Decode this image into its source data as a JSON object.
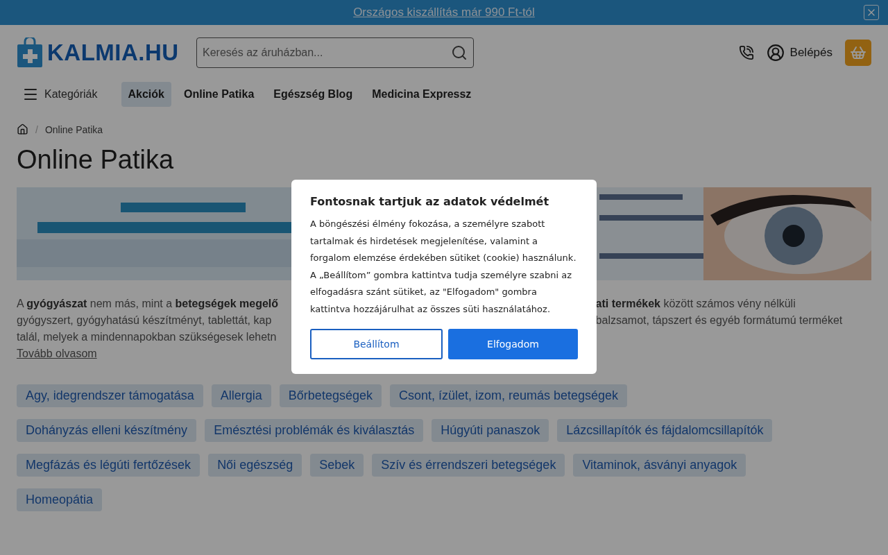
{
  "top_bar": {
    "text": "Országos kiszállítás már 990 Ft-tól"
  },
  "header": {
    "logo": "KALMIA.HU",
    "search": {
      "placeholder": "Keresés az áruházban..."
    },
    "login": "Belépés"
  },
  "nav": {
    "menu_label": "Kategóriák",
    "items": [
      {
        "label": "Akciók",
        "selected": true
      },
      {
        "label": "Online Patika",
        "selected": false
      },
      {
        "label": "Egészség Blog",
        "selected": false
      },
      {
        "label": "Medicina Expressz",
        "selected": false
      }
    ]
  },
  "breadcrumb": {
    "separator": "/",
    "items": [
      "Online Patika"
    ]
  },
  "title": "Online Patika",
  "banner": {
    "kind": "picture"
  },
  "description": {
    "left_lines": [
      "A **gyógyászat** nem más, mint a **betegségek megelő**",
      "gyógyszert, gyógyhatású készítményt, tablettát, kap",
      "talál, melyek a mindennapokban szükségesek lehetn"
    ],
    "right_lines": [
      "**ati termékek** között számos vény nélküli",
      "balzsamot, tápszert és egyéb formátumú terméket"
    ],
    "more_link": "Tovább olvasom"
  },
  "categories": [
    [
      "Agy, idegrendszer támogatása",
      "Allergia",
      "Bőrbetegségek",
      "Csont, ízület, izom, reumás betegségek"
    ],
    [
      "Dohányzás elleni készítmény",
      "Emésztési problémák és kiválasztás",
      "Húgyúti panaszok",
      "Lázcsillapítók és fájdalomcsillapítók"
    ],
    [
      "Megfázás és légúti fertőzések",
      "Női egészség",
      "Sebek",
      "Szív és érrendszeri betegségek",
      "Vitaminok, ásványi anyagok"
    ],
    [
      "Homeopátia"
    ]
  ],
  "cookie_dialog": {
    "title": "Fontosnak tartjuk az adatok védelmét",
    "body": "A böngészési élmény fokozása, a személyre szabott tartalmak és hirdetések megjelenítése, valamint a forgalom elemzése érdekében sütiket (cookie) használunk. A „Beállítom” gombra kattintva tudja személyre szabni az elfogadásra szánt sütiket, az \"Elfogadom\" gombra kattintva hozzájárulhat az összes süti használatához.",
    "buttons": [
      {
        "label": "Beállítom",
        "kind": "outline"
      },
      {
        "label": "Elfogadom",
        "kind": "primary"
      }
    ]
  }
}
